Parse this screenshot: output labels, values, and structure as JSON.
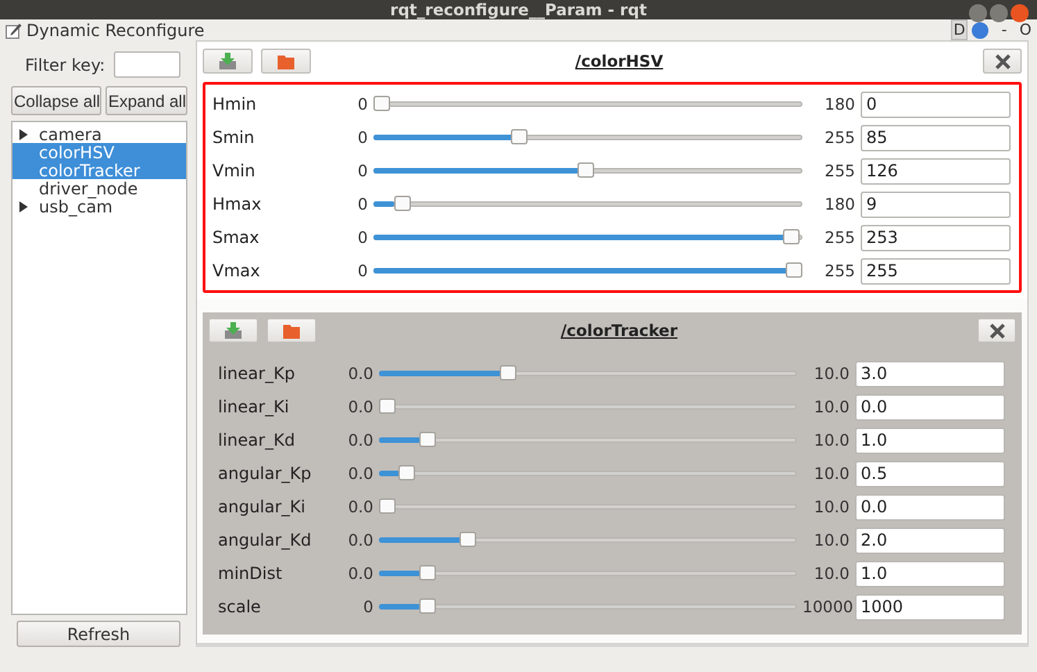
{
  "window": {
    "title": "rqt_reconfigure__Param - rqt"
  },
  "plugin": {
    "title": "Dynamic Reconfigure",
    "help_label": "D",
    "minimize_label": "-",
    "float_label": "O"
  },
  "sidebar": {
    "filter_label": "Filter key:",
    "collapse_button": "Collapse all",
    "expand_button": "Expand all",
    "refresh_button": "Refresh",
    "items": [
      {
        "label": "camera",
        "kind": "group",
        "selected": false
      },
      {
        "label": "colorHSV",
        "kind": "leaf",
        "selected": true
      },
      {
        "label": "colorTracker",
        "kind": "leaf",
        "selected": true
      },
      {
        "label": "driver_node",
        "kind": "leaf",
        "selected": false
      },
      {
        "label": "usb_cam",
        "kind": "group",
        "selected": false
      }
    ]
  },
  "panels": [
    {
      "title": "/colorHSV",
      "selected": false,
      "highlighted": true,
      "params": [
        {
          "name": "Hmin",
          "min": "0",
          "max": "180",
          "value": "0",
          "level": 0
        },
        {
          "name": "Smin",
          "min": "0",
          "max": "255",
          "value": "85",
          "level": 0.333
        },
        {
          "name": "Vmin",
          "min": "0",
          "max": "255",
          "value": "126",
          "level": 0.494
        },
        {
          "name": "Hmax",
          "min": "0",
          "max": "180",
          "value": "9",
          "level": 0.05
        },
        {
          "name": "Smax",
          "min": "0",
          "max": "255",
          "value": "253",
          "level": 0.992
        },
        {
          "name": "Vmax",
          "min": "0",
          "max": "255",
          "value": "255",
          "level": 1
        }
      ]
    },
    {
      "title": "/colorTracker",
      "selected": true,
      "highlighted": false,
      "params": [
        {
          "name": "linear_Kp",
          "min": "0.0",
          "max": "10.0",
          "value": "3.0",
          "level": 0.3
        },
        {
          "name": "linear_Ki",
          "min": "0.0",
          "max": "10.0",
          "value": "0.0",
          "level": 0
        },
        {
          "name": "linear_Kd",
          "min": "0.0",
          "max": "10.0",
          "value": "1.0",
          "level": 0.1
        },
        {
          "name": "angular_Kp",
          "min": "0.0",
          "max": "10.0",
          "value": "0.5",
          "level": 0.05
        },
        {
          "name": "angular_Ki",
          "min": "0.0",
          "max": "10.0",
          "value": "0.0",
          "level": 0
        },
        {
          "name": "angular_Kd",
          "min": "0.0",
          "max": "10.0",
          "value": "2.0",
          "level": 0.2
        },
        {
          "name": "minDist",
          "min": "0.0",
          "max": "10.0",
          "value": "1.0",
          "level": 0.1
        },
        {
          "name": "scale",
          "min": "0",
          "max": "10000",
          "value": "1000",
          "level": 0.1
        }
      ]
    }
  ]
}
